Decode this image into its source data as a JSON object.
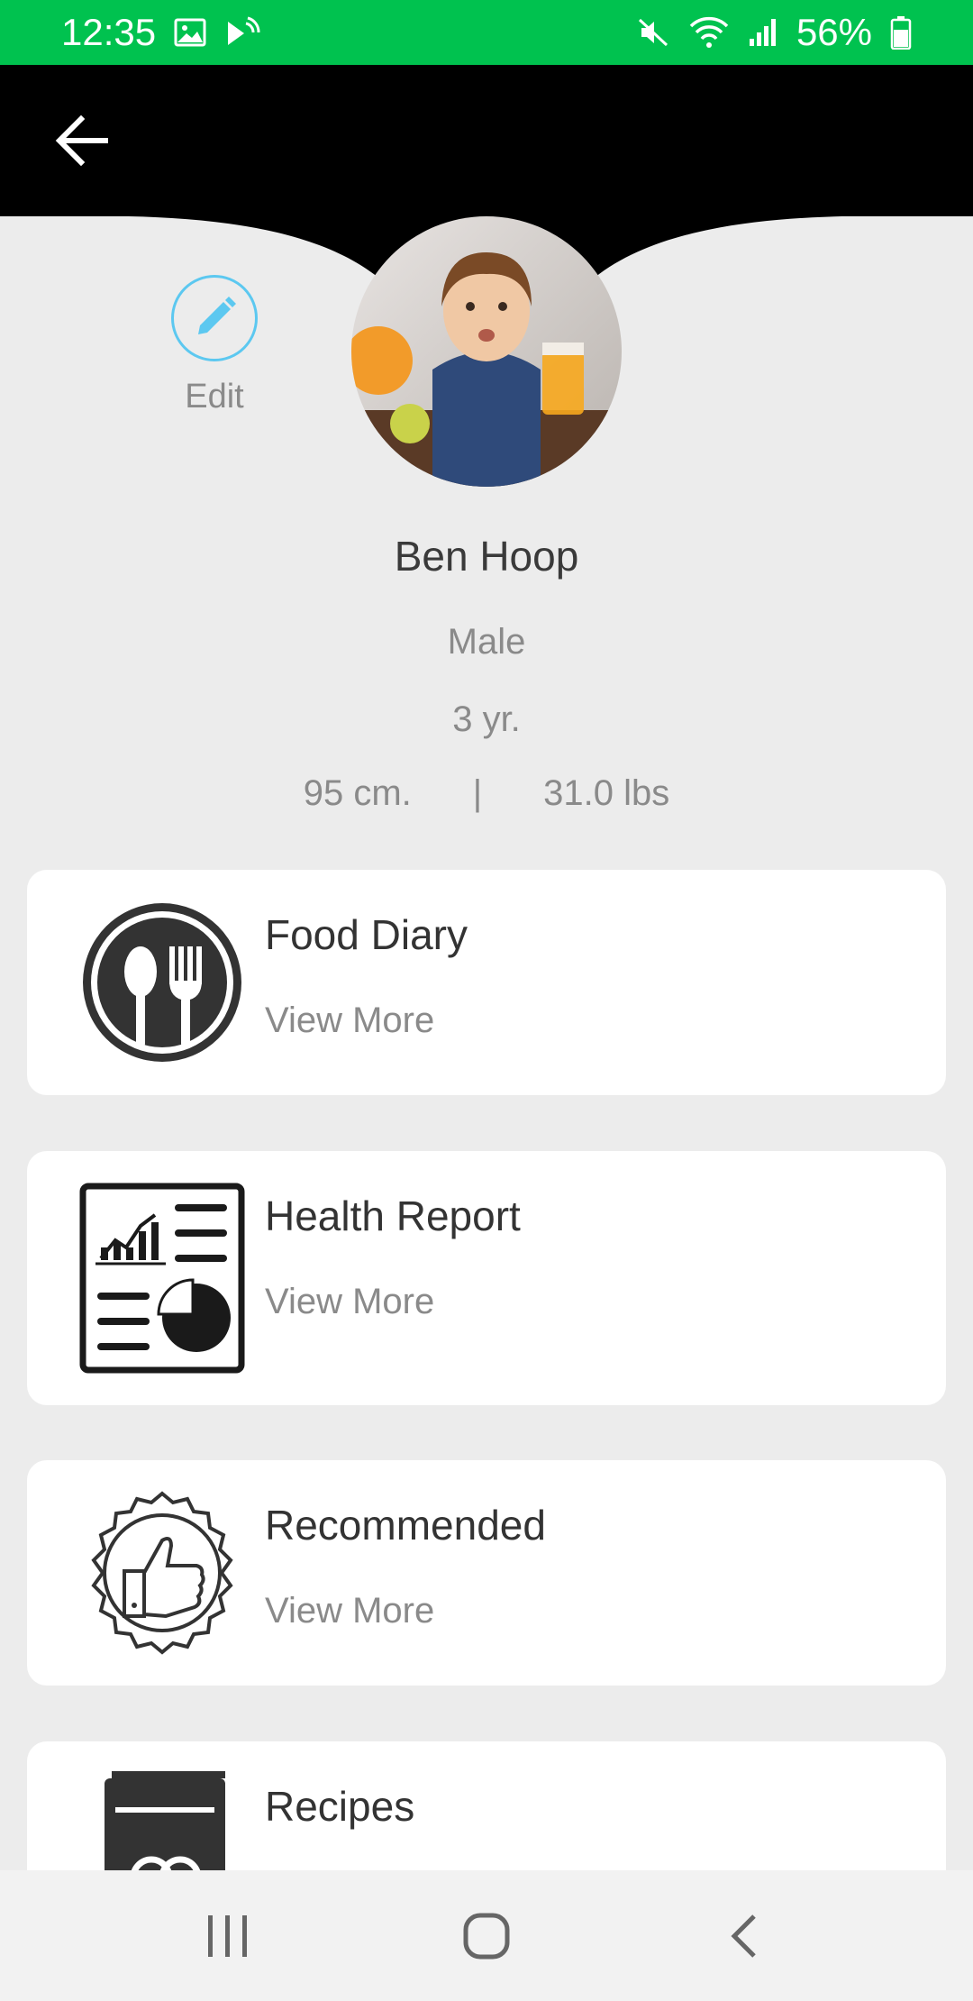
{
  "status_bar": {
    "time": "12:35",
    "battery": "56%",
    "icons": [
      "image-icon",
      "cast-icon",
      "mute-icon",
      "wifi-icon",
      "signal-icon",
      "battery-icon"
    ]
  },
  "header": {
    "back_icon": "arrow-left-icon",
    "background": "#000000"
  },
  "profile": {
    "edit_label": "Edit",
    "name": "Ben Hoop",
    "gender": "Male",
    "age": "3 yr.",
    "height": "95 cm.",
    "separator": "|",
    "weight": "31.0 lbs"
  },
  "cards": [
    {
      "title": "Food Diary",
      "link": "View More",
      "icon": "spoon-fork-icon"
    },
    {
      "title": "Health Report",
      "link": "View More",
      "icon": "report-icon"
    },
    {
      "title": "Recommended",
      "link": "View More",
      "icon": "thumbs-up-badge-icon"
    },
    {
      "title": "Recipes",
      "icon": "recipe-book-icon"
    }
  ],
  "colors": {
    "status_bar": "#00c24f",
    "edit_accent": "#5cc8f0",
    "page_background": "#ececec"
  },
  "nav_bar": {
    "icons": [
      "recent-apps-icon",
      "home-icon",
      "back-nav-icon"
    ]
  }
}
